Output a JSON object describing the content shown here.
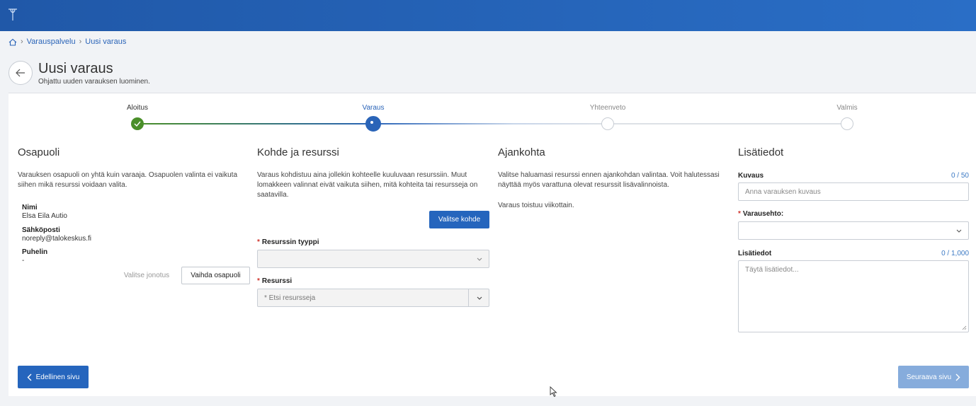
{
  "breadcrumb": {
    "items": [
      "Varauspalvelu",
      "Uusi varaus"
    ]
  },
  "header": {
    "title": "Uusi varaus",
    "subtitle": "Ohjattu uuden varauksen luominen."
  },
  "stepper": {
    "steps": [
      {
        "label": "Aloitus",
        "state": "done"
      },
      {
        "label": "Varaus",
        "state": "active"
      },
      {
        "label": "Yhteenveto",
        "state": "todo"
      },
      {
        "label": "Valmis",
        "state": "todo"
      }
    ],
    "colors": {
      "done": "#4a8f29",
      "active": "#2a64b8",
      "todo": "#c8cdd4"
    }
  },
  "osapuoli": {
    "heading": "Osapuoli",
    "description": "Varauksen osapuoli on yhtä kuin varaaja. Osapuolen valinta ei vaikuta siihen mikä resurssi voidaan valita.",
    "name_label": "Nimi",
    "name_value": "Elsa Eila Autio",
    "email_label": "Sähköposti",
    "email_value": "noreply@talokeskus.fi",
    "phone_label": "Puhelin",
    "phone_value": "-",
    "queue_button": "Valitse jonotus",
    "change_button": "Vaihda osapuoli"
  },
  "kohde": {
    "heading": "Kohde ja resurssi",
    "description": "Varaus kohdistuu aina jollekin kohteelle kuuluvaan resurssiin. Muut lomakkeen valinnat eivät vaikuta siihen, mitä kohteita tai resursseja on saatavilla.",
    "select_button": "Valitse kohde",
    "type_label": "Resurssin tyyppi",
    "resource_label": "Resurssi",
    "resource_placeholder": "* Etsi resursseja"
  },
  "ajankohta": {
    "heading": "Ajankohta",
    "description": "Valitse haluamasi resurssi ennen ajankohdan valintaa. Voit halutessasi näyttää myös varattuna olevat resurssit lisävalinnoista.",
    "recurrence": "Varaus toistuu viikottain."
  },
  "lisatiedot": {
    "heading": "Lisätiedot",
    "description_label": "Kuvaus",
    "description_counter": "0 / 50",
    "description_placeholder": "Anna varauksen kuvaus",
    "terms_label": "Varausehto:",
    "extra_label": "Lisätiedot",
    "extra_counter": "0 / 1,000",
    "extra_placeholder": "Täytä lisätiedot..."
  },
  "footer": {
    "prev_button": "Edellinen sivu",
    "next_button": "Seuraava sivu"
  }
}
